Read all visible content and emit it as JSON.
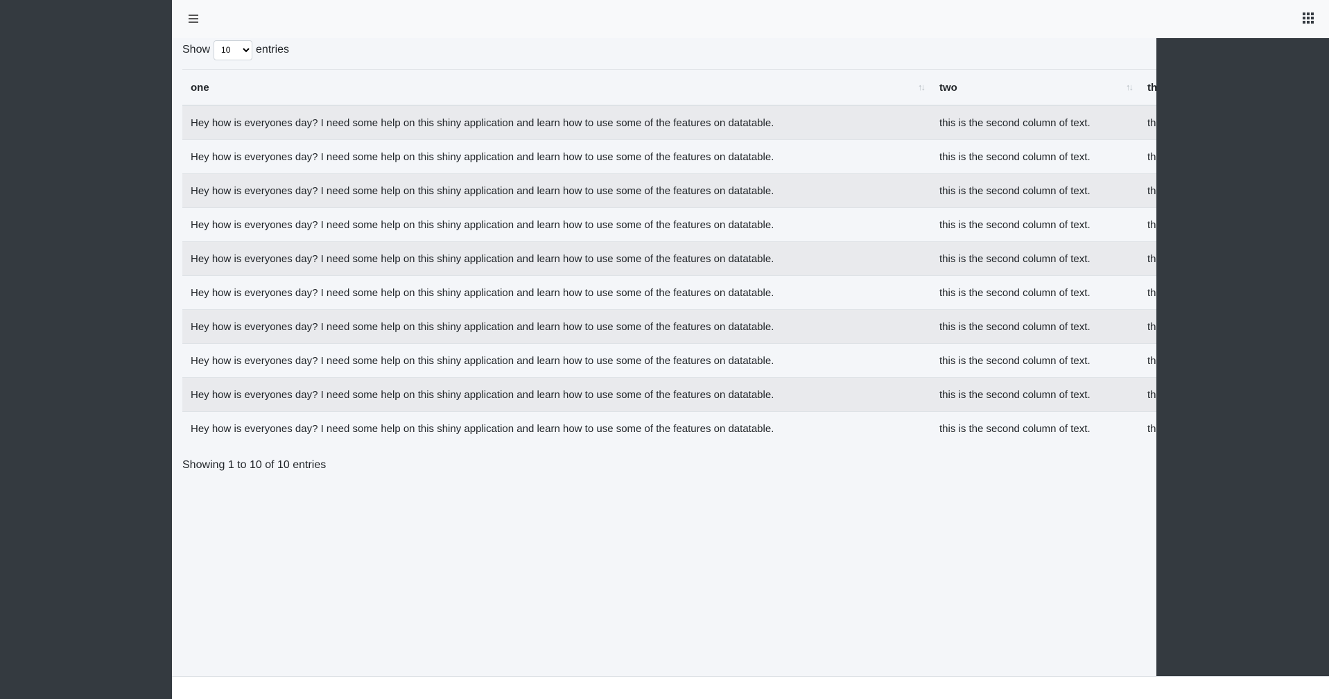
{
  "length_menu": {
    "show_label": "Show",
    "selected": "10",
    "entries_label": "entries"
  },
  "table": {
    "columns": [
      "one",
      "two",
      "thre"
    ],
    "rows": [
      [
        "Hey how is everyones day? I need some help on this shiny application and learn how to use some of the features on datatable.",
        "this is the second column of text.",
        "this"
      ],
      [
        "Hey how is everyones day? I need some help on this shiny application and learn how to use some of the features on datatable.",
        "this is the second column of text.",
        "this"
      ],
      [
        "Hey how is everyones day? I need some help on this shiny application and learn how to use some of the features on datatable.",
        "this is the second column of text.",
        "this"
      ],
      [
        "Hey how is everyones day? I need some help on this shiny application and learn how to use some of the features on datatable.",
        "this is the second column of text.",
        "this"
      ],
      [
        "Hey how is everyones day? I need some help on this shiny application and learn how to use some of the features on datatable.",
        "this is the second column of text.",
        "this"
      ],
      [
        "Hey how is everyones day? I need some help on this shiny application and learn how to use some of the features on datatable.",
        "this is the second column of text.",
        "this"
      ],
      [
        "Hey how is everyones day? I need some help on this shiny application and learn how to use some of the features on datatable.",
        "this is the second column of text.",
        "this"
      ],
      [
        "Hey how is everyones day? I need some help on this shiny application and learn how to use some of the features on datatable.",
        "this is the second column of text.",
        "this"
      ],
      [
        "Hey how is everyones day? I need some help on this shiny application and learn how to use some of the features on datatable.",
        "this is the second column of text.",
        "this"
      ],
      [
        "Hey how is everyones day? I need some help on this shiny application and learn how to use some of the features on datatable.",
        "this is the second column of text.",
        "this"
      ]
    ]
  },
  "info_text": "Showing 1 to 10 of 10 entries",
  "icons": {
    "menu": "hamburger-menu-icon",
    "apps": "grid-apps-icon",
    "sort": "sort-arrows-icon"
  },
  "colors": {
    "sidebar": "#343a40",
    "content_bg": "#f4f6f9",
    "stripe": "#e9eaed"
  }
}
